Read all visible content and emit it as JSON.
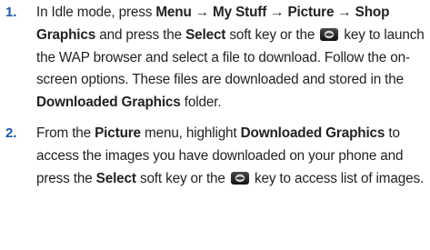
{
  "steps": [
    {
      "number": "1.",
      "segments": [
        {
          "t": "In Idle mode, press ",
          "b": false
        },
        {
          "t": "Menu → My Stuff  → Picture → Shop Graphics",
          "b": true
        },
        {
          "t": " and press the ",
          "b": false
        },
        {
          "t": "Select",
          "b": true
        },
        {
          "t": " soft key or the ",
          "b": false
        },
        {
          "icon": "center-select-key-icon"
        },
        {
          "t": " key to launch the WAP browser and select a file to download. Follow the on-screen options. These files are downloaded and stored in the ",
          "b": false
        },
        {
          "t": "Downloaded Graphics",
          "b": true
        },
        {
          "t": " folder.",
          "b": false
        }
      ]
    },
    {
      "number": "2.",
      "segments": [
        {
          "t": "From the ",
          "b": false
        },
        {
          "t": "Picture",
          "b": true
        },
        {
          "t": " menu, highlight ",
          "b": false
        },
        {
          "t": "Downloaded Graphics",
          "b": true
        },
        {
          "t": " to access the images you have downloaded on your phone and press the ",
          "b": false
        },
        {
          "t": "Select",
          "b": true
        },
        {
          "t": " soft key or the ",
          "b": false
        },
        {
          "icon": "center-select-key-icon"
        },
        {
          "t": " key to access list of images.",
          "b": false
        }
      ]
    }
  ],
  "colors": {
    "step_number": "#1f5aa6",
    "text": "#231f20",
    "key_icon": "#1a1a1a"
  }
}
